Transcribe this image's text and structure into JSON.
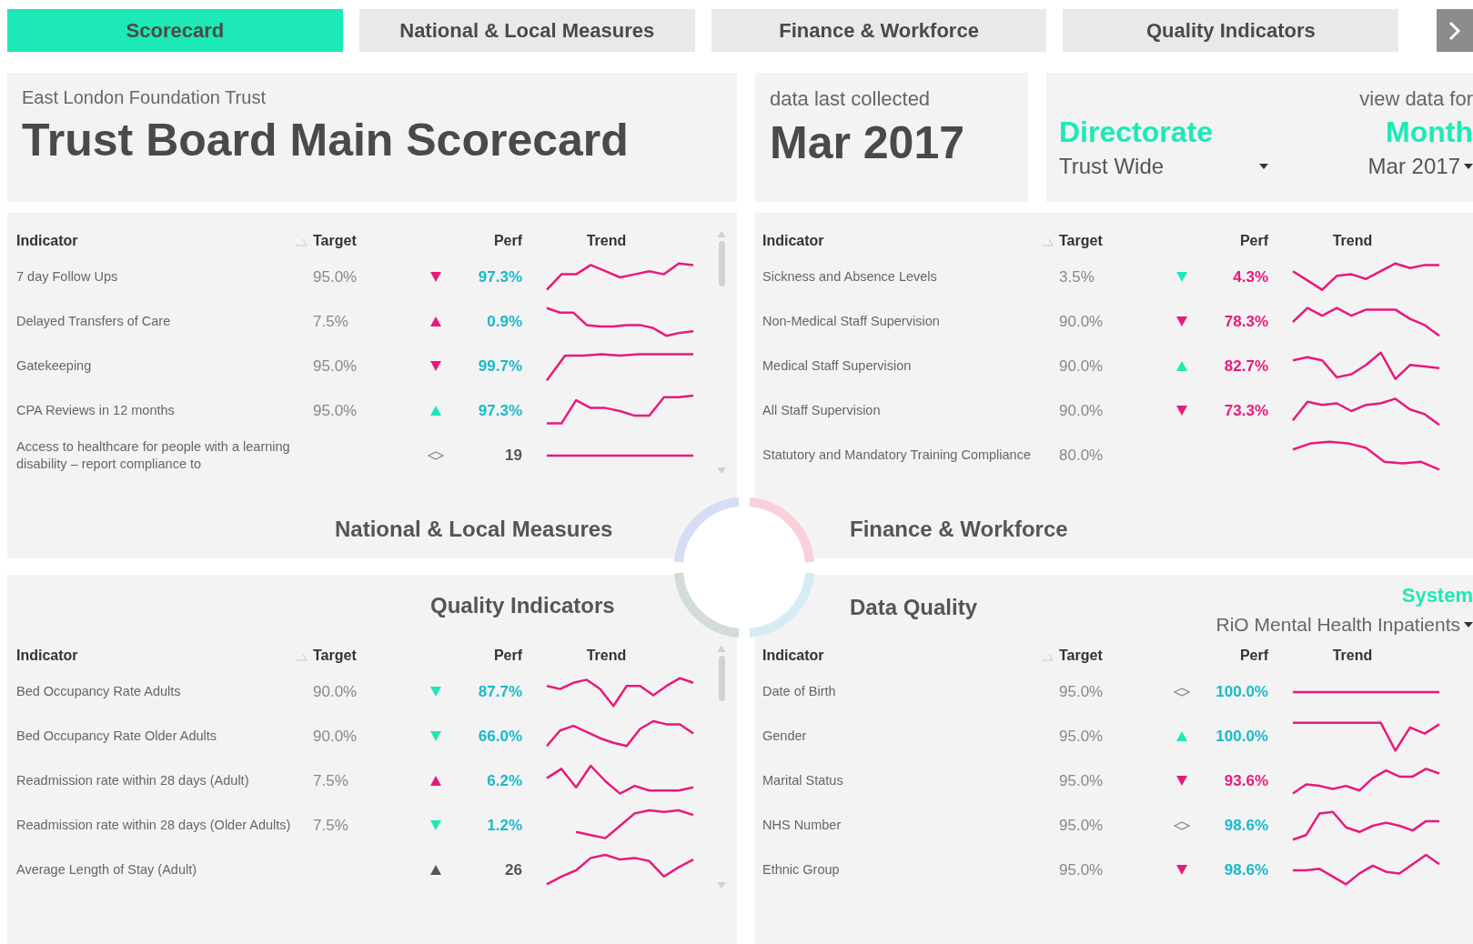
{
  "tabs": [
    {
      "label": "Scorecard",
      "selected": true
    },
    {
      "label": "National & Local Measures",
      "selected": false
    },
    {
      "label": "Finance & Workforce",
      "selected": false
    },
    {
      "label": "Quality Indicators",
      "selected": false
    }
  ],
  "header": {
    "organisation": "East London Foundation Trust",
    "title": "Trust Board Main Scorecard",
    "collected_label": "data last collected",
    "collected_value": "Mar 2017",
    "view_label": "view data for",
    "directorate_label": "Directorate",
    "directorate_value": "Trust Wide",
    "month_label": "Month",
    "month_value": "Mar 2017"
  },
  "national_local": {
    "title": "National & Local Measures",
    "columns": [
      "Indicator",
      "Target",
      "Perf",
      "Trend"
    ],
    "rows": [
      {
        "indicator": "7 day Follow Ups",
        "target": "95.0%",
        "arrow": {
          "kind": "down",
          "color": "#e8197d"
        },
        "perf": {
          "text": "97.3%",
          "color": "#19b9c9"
        }
      },
      {
        "indicator": "Delayed Transfers of Care",
        "target": "7.5%",
        "arrow": {
          "kind": "up",
          "color": "#e8197d"
        },
        "perf": {
          "text": "0.9%",
          "color": "#19b9c9"
        }
      },
      {
        "indicator": "Gatekeeping",
        "target": "95.0%",
        "arrow": {
          "kind": "down",
          "color": "#e8197d"
        },
        "perf": {
          "text": "99.7%",
          "color": "#19b9c9"
        }
      },
      {
        "indicator": "CPA Reviews in 12 months",
        "target": "95.0%",
        "arrow": {
          "kind": "up",
          "color": "#1de9b6"
        },
        "perf": {
          "text": "97.3%",
          "color": "#19b9c9"
        }
      },
      {
        "indicator": "Access to healthcare for people with a learning disability – report compliance to",
        "arrow": {
          "kind": "same",
          "color": "#8a8a8a"
        },
        "perf": {
          "text": "19",
          "color": "#555555"
        }
      }
    ]
  },
  "finance_workforce": {
    "title": "Finance & Workforce",
    "columns": [
      "Indicator",
      "Target",
      "Perf",
      "Trend"
    ],
    "rows": [
      {
        "indicator": "Sickness and Absence Levels",
        "target": "3.5%",
        "arrow": {
          "kind": "down",
          "color": "#1de9b6"
        },
        "perf": {
          "text": "4.3%",
          "color": "#e8197d"
        }
      },
      {
        "indicator": "Non-Medical Staff Supervision",
        "target": "90.0%",
        "arrow": {
          "kind": "down",
          "color": "#e8197d"
        },
        "perf": {
          "text": "78.3%",
          "color": "#e8197d"
        }
      },
      {
        "indicator": "Medical Staff Supervision",
        "target": "90.0%",
        "arrow": {
          "kind": "up",
          "color": "#1de9b6"
        },
        "perf": {
          "text": "82.7%",
          "color": "#e8197d"
        }
      },
      {
        "indicator": "All Staff Supervision",
        "target": "90.0%",
        "arrow": {
          "kind": "down",
          "color": "#e8197d"
        },
        "perf": {
          "text": "73.3%",
          "color": "#e8197d"
        }
      },
      {
        "indicator": "Statutory and Mandatory Training Compliance",
        "target": "80.0%"
      }
    ]
  },
  "quality_indicators": {
    "title": "Quality Indicators",
    "columns": [
      "Indicator",
      "Target",
      "Perf",
      "Trend"
    ],
    "rows": [
      {
        "indicator": "Bed Occupancy Rate Adults",
        "target": "90.0%",
        "arrow": {
          "kind": "down",
          "color": "#1de9b6"
        },
        "perf": {
          "text": "87.7%",
          "color": "#19b9c9"
        }
      },
      {
        "indicator": "Bed Occupancy Rate Older Adults",
        "target": "90.0%",
        "arrow": {
          "kind": "down",
          "color": "#1de9b6"
        },
        "perf": {
          "text": "66.0%",
          "color": "#19b9c9"
        }
      },
      {
        "indicator": "Readmission rate within 28 days (Adult)",
        "target": "7.5%",
        "arrow": {
          "kind": "up",
          "color": "#e8197d"
        },
        "perf": {
          "text": "6.2%",
          "color": "#19b9c9"
        }
      },
      {
        "indicator": "Readmission rate within 28 days (Older Adults)",
        "target": "7.5%",
        "arrow": {
          "kind": "down",
          "color": "#1de9b6"
        },
        "perf": {
          "text": "1.2%",
          "color": "#19b9c9"
        }
      },
      {
        "indicator": "Average Length of Stay (Adult)",
        "arrow": {
          "kind": "up",
          "color": "#555555"
        },
        "perf": {
          "text": "26",
          "color": "#555555"
        }
      }
    ]
  },
  "data_quality": {
    "title": "Data Quality",
    "system_label": "System",
    "system_value": "RiO Mental Health Inpatients",
    "columns": [
      "Indicator",
      "Target",
      "Perf",
      "Trend"
    ],
    "rows": [
      {
        "indicator": "Date of Birth",
        "target": "95.0%",
        "arrow": {
          "kind": "same",
          "color": "#8a8a8a"
        },
        "perf": {
          "text": "100.0%",
          "color": "#19b9c9"
        }
      },
      {
        "indicator": "Gender",
        "target": "95.0%",
        "arrow": {
          "kind": "up",
          "color": "#1de9b6"
        },
        "perf": {
          "text": "100.0%",
          "color": "#19b9c9"
        }
      },
      {
        "indicator": "Marital Status",
        "target": "95.0%",
        "arrow": {
          "kind": "down",
          "color": "#e8197d"
        },
        "perf": {
          "text": "93.6%",
          "color": "#e8197d"
        }
      },
      {
        "indicator": "NHS Number",
        "target": "95.0%",
        "arrow": {
          "kind": "same",
          "color": "#8a8a8a"
        },
        "perf": {
          "text": "98.6%",
          "color": "#19b9c9"
        }
      },
      {
        "indicator": "Ethnic Group",
        "target": "95.0%",
        "arrow": {
          "kind": "down",
          "color": "#e8197d"
        },
        "perf": {
          "text": "98.6%",
          "color": "#19b9c9"
        }
      }
    ]
  }
}
